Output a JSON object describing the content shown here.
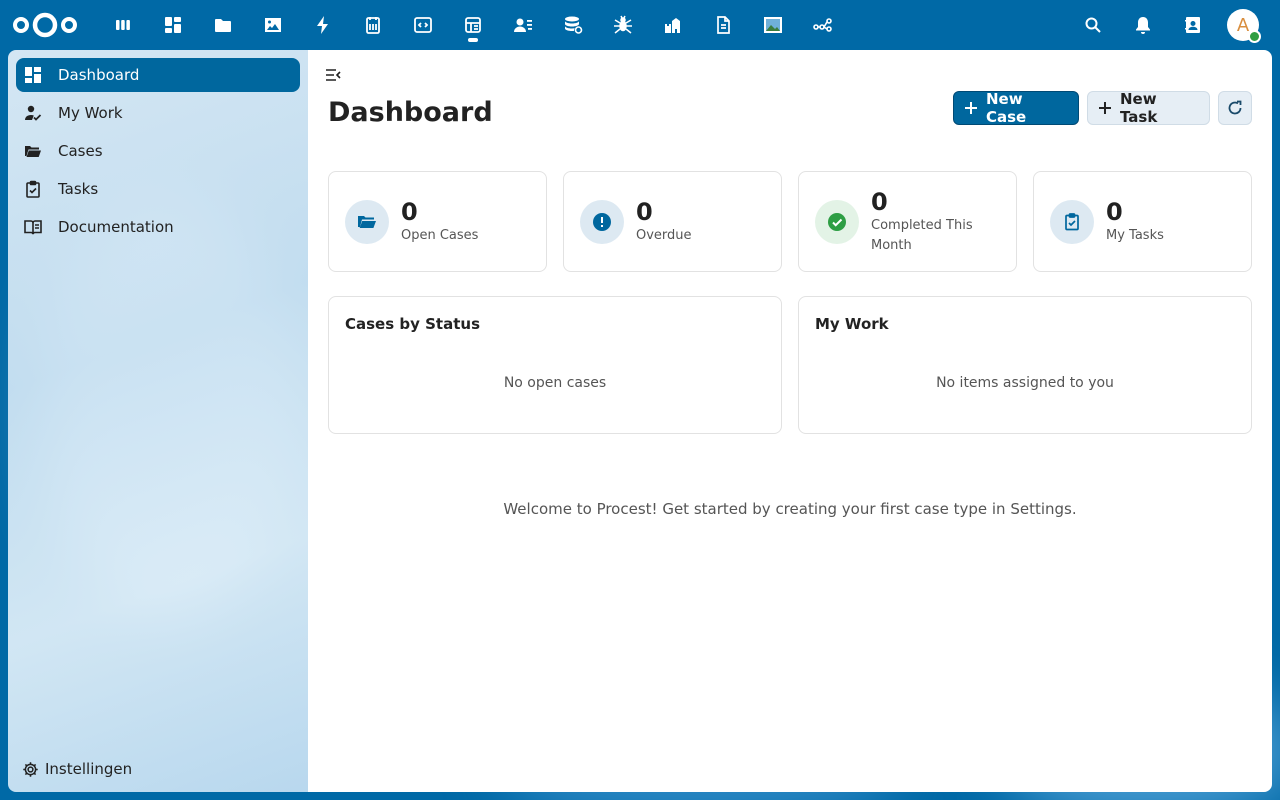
{
  "topbar": {
    "apps": [
      {
        "name": "deck-icon"
      },
      {
        "name": "dashboard-app-icon"
      },
      {
        "name": "files-icon"
      },
      {
        "name": "photos-icon"
      },
      {
        "name": "activity-icon"
      },
      {
        "name": "forms-icon"
      },
      {
        "name": "code-icon"
      },
      {
        "name": "procest-app-icon"
      },
      {
        "name": "contacts-icon"
      },
      {
        "name": "database-icon"
      },
      {
        "name": "spider-icon"
      },
      {
        "name": "castle-icon"
      },
      {
        "name": "document-icon"
      },
      {
        "name": "image-icon"
      },
      {
        "name": "flow-icon"
      }
    ],
    "avatar_initial": "A"
  },
  "sidebar": {
    "items": [
      {
        "label": "Dashboard",
        "icon": "dashboard-icon"
      },
      {
        "label": "My Work",
        "icon": "user-check-icon"
      },
      {
        "label": "Cases",
        "icon": "folder-open-icon"
      },
      {
        "label": "Tasks",
        "icon": "clipboard-check-icon"
      },
      {
        "label": "Documentation",
        "icon": "book-open-icon"
      }
    ],
    "settings_label": "Instellingen"
  },
  "main": {
    "title": "Dashboard",
    "new_case_label": "New Case",
    "new_task_label": "New Task",
    "stats": [
      {
        "value": "0",
        "label": "Open Cases"
      },
      {
        "value": "0",
        "label": "Overdue"
      },
      {
        "value": "0",
        "label": "Completed This Month"
      },
      {
        "value": "0",
        "label": "My Tasks"
      }
    ],
    "panels": [
      {
        "title": "Cases by Status",
        "empty": "No open cases"
      },
      {
        "title": "My Work",
        "empty": "No items assigned to you"
      }
    ],
    "welcome": "Welcome to Procest! Get started by creating your first case type in Settings."
  },
  "colors": {
    "brand": "#00679e",
    "success": "#2e9e44"
  }
}
